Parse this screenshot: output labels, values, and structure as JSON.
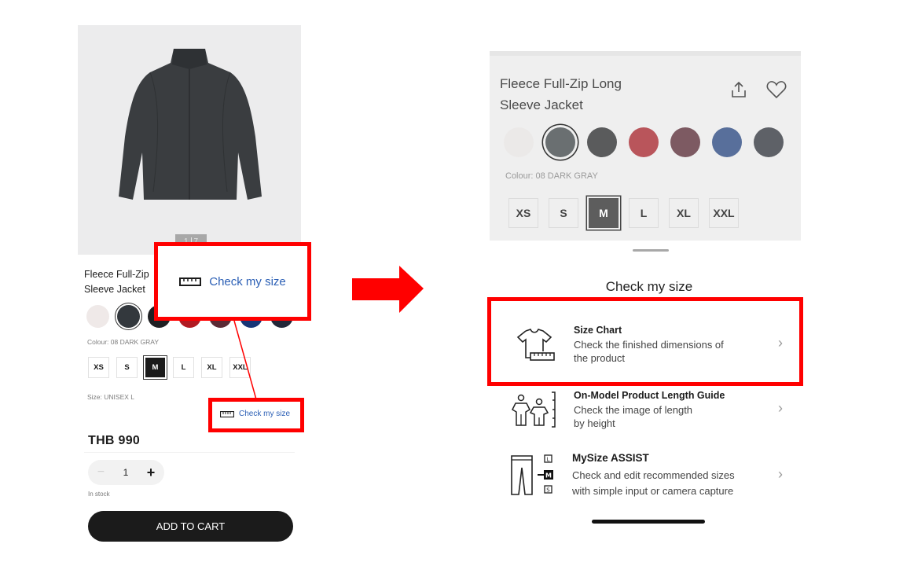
{
  "left_screen": {
    "product_image": "dark-gray-fleece-jacket",
    "pager": {
      "current": "1",
      "total": "7"
    },
    "product_title_line1": "Fleece Full-Zip",
    "product_title_line2": "Sleeve Jacket",
    "colour_swatches": [
      {
        "name": "off-white",
        "color": "#efe9e8",
        "selected": false
      },
      {
        "name": "dark-gray",
        "color": "#33383d",
        "selected": true
      },
      {
        "name": "black",
        "color": "#1f2023",
        "selected": false
      },
      {
        "name": "red",
        "color": "#b11a22",
        "selected": false
      },
      {
        "name": "wine",
        "color": "#5a2a35",
        "selected": false
      },
      {
        "name": "navy",
        "color": "#173576",
        "selected": false
      },
      {
        "name": "dark-navy",
        "color": "#232839",
        "selected": false
      }
    ],
    "colour_label": "Colour: 08 DARK GRAY",
    "sizes": [
      "XS",
      "S",
      "M",
      "L",
      "XL",
      "XXL"
    ],
    "selected_size": "M",
    "size_label": "Size: UNISEX L",
    "check_size_label": "Check my size",
    "price": "THB 990",
    "quantity": "1",
    "quantity_minus": "−",
    "quantity_plus": "+",
    "stock_status": "In stock",
    "add_to_cart_label": "ADD TO CART"
  },
  "callout": {
    "label": "Check my size",
    "highlight_color": "#ff0000"
  },
  "right_screen": {
    "product_title_line1": "Fleece Full-Zip Long",
    "product_title_line2": "Sleeve Jacket",
    "colour_swatches": [
      {
        "name": "off-white",
        "color": "#ebe9e8",
        "selected": false
      },
      {
        "name": "dark-gray",
        "color": "#6a6f71",
        "selected": true
      },
      {
        "name": "charcoal",
        "color": "#5a5b5c",
        "selected": false
      },
      {
        "name": "red",
        "color": "#b9555b",
        "selected": false
      },
      {
        "name": "wine",
        "color": "#7d5a62",
        "selected": false
      },
      {
        "name": "blue",
        "color": "#586f9b",
        "selected": false
      },
      {
        "name": "slate",
        "color": "#5e6167",
        "selected": false
      }
    ],
    "colour_label": "Colour: 08 DARK GRAY",
    "sizes": [
      "XS",
      "S",
      "M",
      "L",
      "XL",
      "XXL"
    ],
    "selected_size": "M",
    "sheet_heading": "Check my size",
    "options": [
      {
        "icon": "tshirt-ruler-icon",
        "title": "Size Chart",
        "desc_line1": "Check the finished dimensions of",
        "desc_line2": "the product"
      },
      {
        "icon": "models-height-icon",
        "title": "On-Model Product Length Guide",
        "desc_line1": "Check the image of length",
        "desc_line2": "by height"
      },
      {
        "icon": "pants-size-icon",
        "title": "MySize ASSIST",
        "desc_line1": "Check and edit recommended sizes",
        "desc_line2": "with simple input or camera capture"
      }
    ],
    "chevron": "›"
  }
}
